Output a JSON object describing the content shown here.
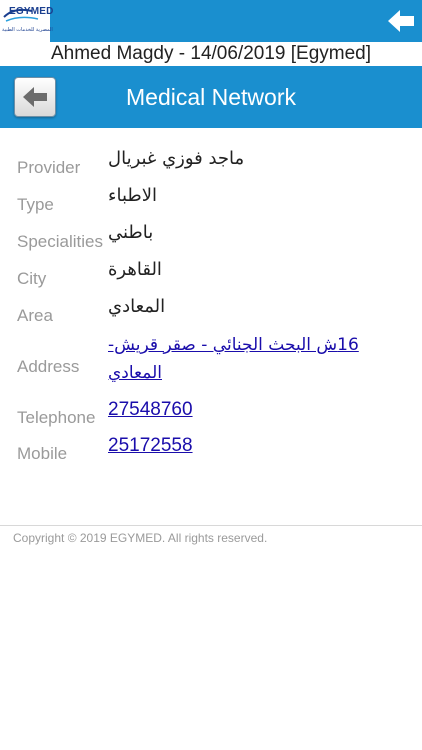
{
  "topbar": {
    "logo_text": "EGYMED",
    "logo_sub": "المصرية للخدمات الطبية"
  },
  "user_line": "Ahmed Magdy - 14/06/2019 [Egymed]",
  "header": {
    "title": "Medical Network"
  },
  "details": {
    "provider": {
      "label": "Provider",
      "value": "ماجد فوزي غبريال"
    },
    "type": {
      "label": "Type",
      "value": "الاطباء"
    },
    "specialities": {
      "label": "Specialities",
      "value": "باطني"
    },
    "city": {
      "label": "City",
      "value": "القاهرة"
    },
    "area": {
      "label": "Area",
      "value": "المعادي"
    },
    "address": {
      "label": "Address",
      "value": "16ش البحث الجنائي - صقر قريش-المعادي"
    },
    "telephone": {
      "label": "Telephone",
      "value": "27548760"
    },
    "mobile": {
      "label": "Mobile",
      "value": "25172558"
    }
  },
  "footer": {
    "copyright": "Copyright © 2019 EGYMED. All rights reserved."
  },
  "colors": {
    "primary": "#1a8fcf",
    "link": "#1a0dab",
    "label": "#9a9a9a"
  }
}
